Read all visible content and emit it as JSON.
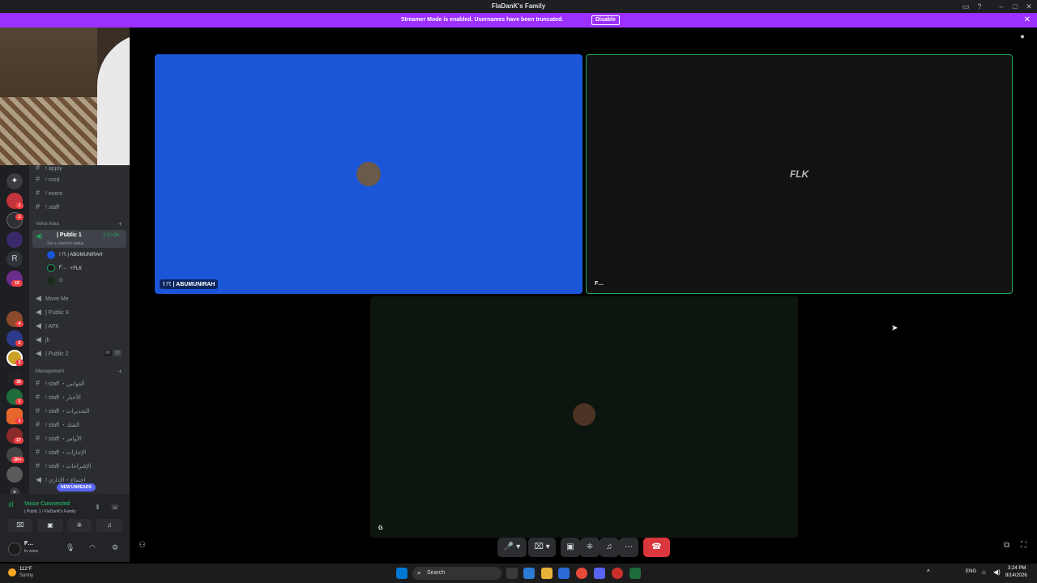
{
  "window": {
    "title": "FlaDanK's Family"
  },
  "banner": {
    "text": "Streamer Mode is enabled. Usernames have been truncated.",
    "disable_label": "Disable"
  },
  "channels": {
    "text_top": [
      "! apply",
      "! mod",
      "! event",
      "! staff"
    ],
    "voice_category": "Voice Area",
    "public1": {
      "name": "| Public 1",
      "timer": "2:10:34",
      "status_hint": "Set a channel status"
    },
    "members": [
      {
        "name": "! ☈ | ABUMUNIRAH"
      },
      {
        "name": "F…",
        "tag": "⚡FLK"
      },
      {
        "name": "G"
      }
    ],
    "voice_list": [
      {
        "name": "Move Me"
      },
      {
        "name": "| Public 3"
      },
      {
        "name": "| AFK"
      },
      {
        "name": "jh"
      },
      {
        "name": "| Public 2",
        "count_a": "00",
        "count_b": "10"
      }
    ],
    "management_category": "Management",
    "management": [
      {
        "name": "! staff ・القوانين"
      },
      {
        "name": "! staff ・الأخبار"
      },
      {
        "name": "! staff ・التحذيرات"
      },
      {
        "name": "! staff ・الشك"
      },
      {
        "name": "! staff ・الأوامر"
      },
      {
        "name": "! staff ・الإجازات"
      },
      {
        "name": "! staff ・الإقتراحات"
      },
      {
        "name": "! اجتماع・الإداري"
      }
    ],
    "new_unreads": "NEW UNREADS"
  },
  "voice": {
    "status": "Voice Connected",
    "detail": "| Public 1 / FlaDanK's Family"
  },
  "user": {
    "name": "F…",
    "status": "In voice"
  },
  "tiles": [
    {
      "name": "! ☈ | ABUMUNIRAH"
    },
    {
      "name": "F…",
      "center_text": "FLK"
    },
    {
      "name": "G"
    }
  ],
  "taskbar": {
    "weather_temp": "112°F",
    "weather_desc": "Sunny",
    "search": "Search",
    "lang": "ENG",
    "time": "3:24 PM",
    "date": "8/14/2026"
  },
  "server_badges": [
    "1",
    "1",
    "15",
    "4",
    "2",
    "3",
    "36",
    "1",
    "1",
    "17",
    "2K+"
  ],
  "colors": {
    "accent": "#9b30ff",
    "speaking": "#23a55a",
    "tile_blue": "#1b56d9",
    "leave": "#da373c"
  }
}
